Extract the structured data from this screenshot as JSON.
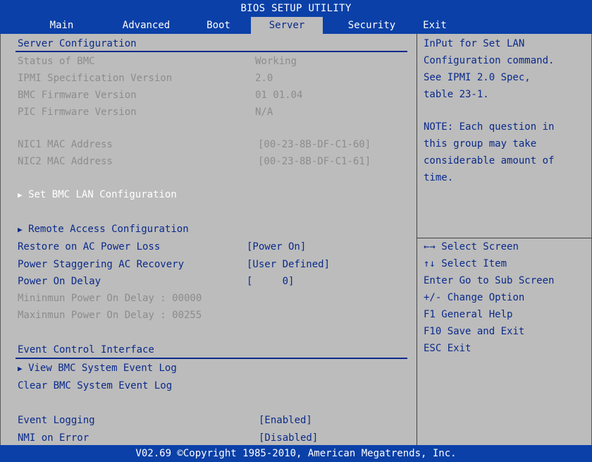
{
  "title": "BIOS SETUP UTILITY",
  "tabs": [
    {
      "label": "Main"
    },
    {
      "label": "Advanced"
    },
    {
      "label": "Boot"
    },
    {
      "label": "Server"
    },
    {
      "label": "Security"
    },
    {
      "label": "Exit"
    }
  ],
  "active_tab": "Server",
  "server_config": {
    "heading": "Server Configuration",
    "status_bmc": {
      "label": "Status of BMC",
      "value": "Working"
    },
    "ipmi_version": {
      "label": "IPMI Specification Version",
      "value": "2.0"
    },
    "bmc_fw": {
      "label": "BMC Firmware Version",
      "value": "01 01.04"
    },
    "pic_fw": {
      "label": "PIC Firmware Version",
      "value": "N/A"
    },
    "nic1": {
      "label": "NIC1 MAC Address",
      "value": "[00-23-8B-DF-C1-60]"
    },
    "nic2": {
      "label": "NIC2 MAC Address",
      "value": "[00-23-8B-DF-C1-61]"
    },
    "set_bmc_lan": "Set BMC LAN Configuration",
    "remote_access": "Remote Access Configuration",
    "restore_ac": {
      "label": "Restore on AC Power Loss",
      "value": "[Power On]"
    },
    "staggering": {
      "label": "Power Staggering AC Recovery",
      "value": "[User Defined]"
    },
    "power_on_delay": {
      "label": "Power On Delay",
      "value": "[     0]"
    },
    "min_delay": "Mininmun Power On Delay : 00000",
    "max_delay": "Maxinmun Power On Delay : 00255"
  },
  "event_control": {
    "heading": "Event Control Interface",
    "view_log": "View BMC System Event Log",
    "clear_log": "Clear BMC System Event Log",
    "event_logging": {
      "label": "Event Logging",
      "value": "[Enabled]"
    },
    "nmi_on_error": {
      "label": "NMI on Error",
      "value": "[Disabled]"
    }
  },
  "help": {
    "description": [
      "InPut for Set LAN",
      "Configuration command.",
      "See IPMI 2.0 Spec,",
      "table 23-1.",
      "",
      "NOTE: Each question in",
      "this group may take",
      "considerable amount of",
      "time."
    ],
    "keys": [
      {
        "key": "←→",
        "action": "Select Screen"
      },
      {
        "key": "↑↓",
        "action": "Select Item"
      },
      {
        "key": "Enter",
        "action": "Go to Sub Screen"
      },
      {
        "key": "+/-",
        "action": "Change Option"
      },
      {
        "key": "F1",
        "action": "General Help"
      },
      {
        "key": "F10",
        "action": "Save and Exit"
      },
      {
        "key": "ESC",
        "action": "Exit"
      }
    ]
  },
  "footer": "V02.69 ©Copyright 1985-2010, American Megatrends, Inc.",
  "colors": {
    "bar_blue": "#0a40a8",
    "background_gray": "#bcbcbc",
    "text_blue": "#0a2a8a",
    "disabled_gray": "#8c8c8c"
  }
}
